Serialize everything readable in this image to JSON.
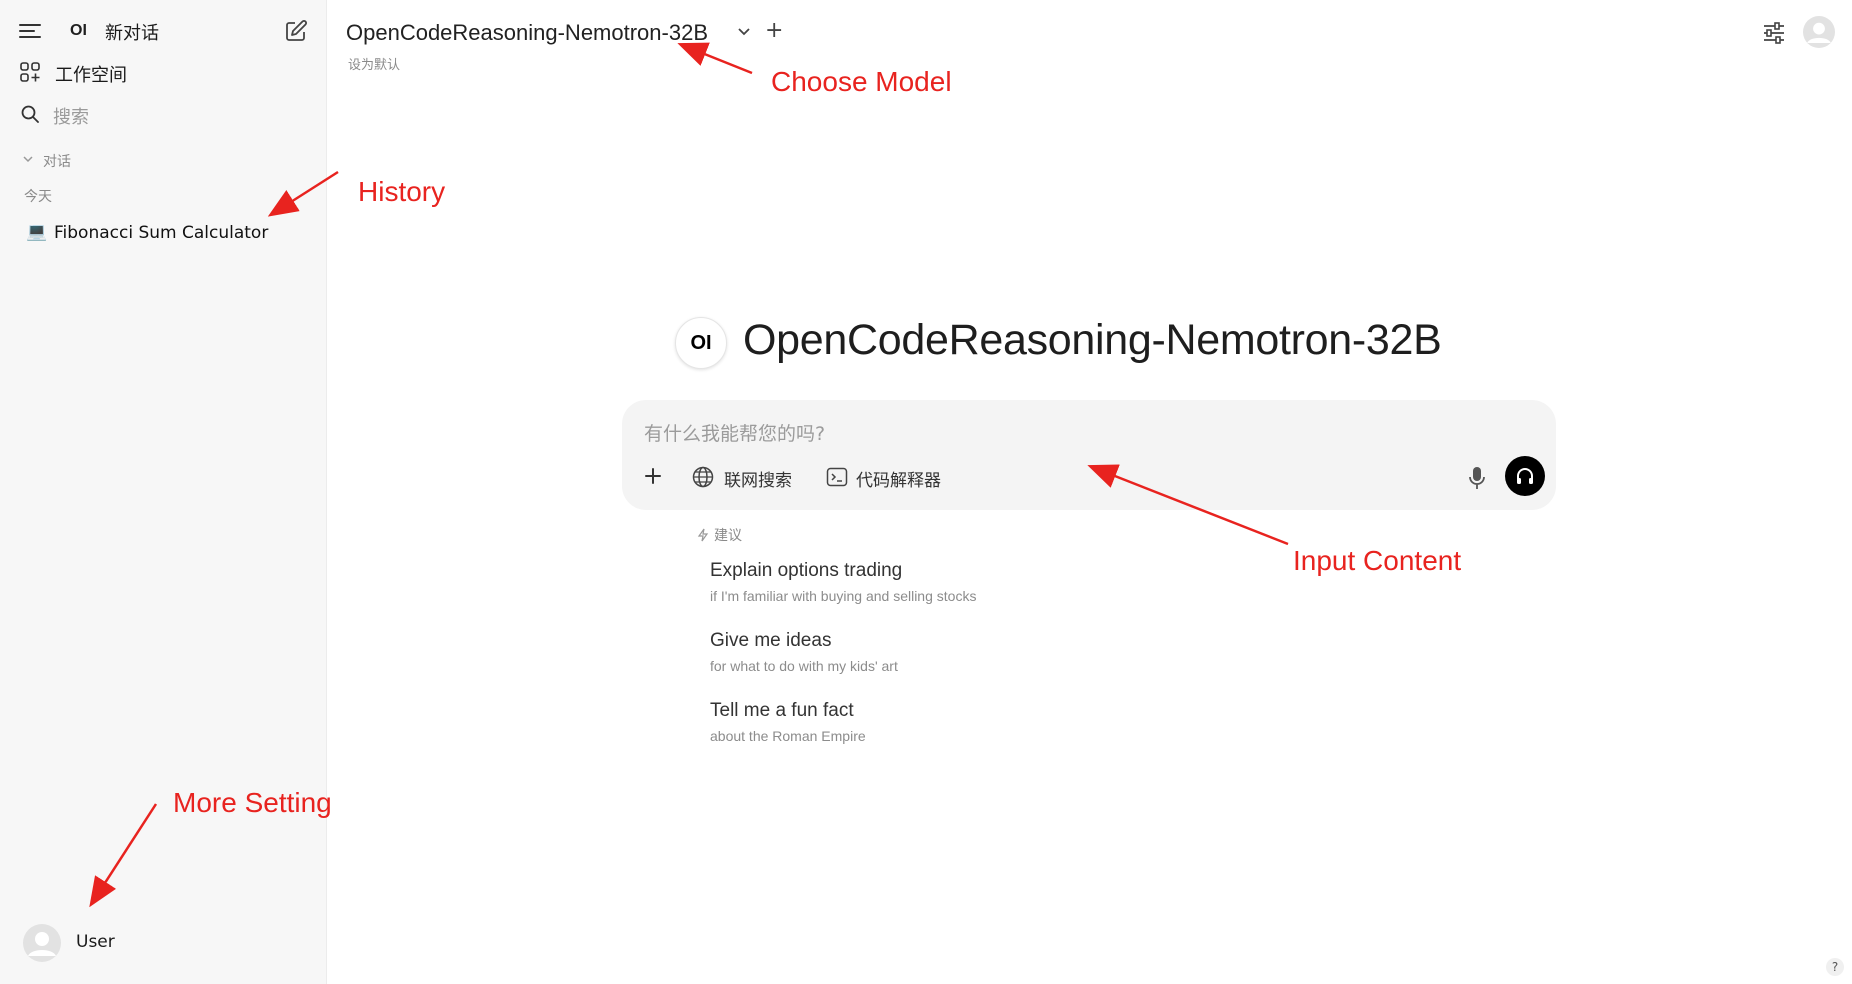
{
  "sidebar": {
    "logo_text": "OI",
    "new_chat_label": "新对话",
    "workspace_label": "工作空间",
    "search_placeholder": "搜索",
    "section_label": "对话",
    "group_today": "今天",
    "chats": [
      {
        "emoji": "💻",
        "title": "Fibonacci Sum Calculator"
      }
    ],
    "user_name": "User"
  },
  "header": {
    "model_name": "OpenCodeReasoning-Nemotron-32B",
    "set_default": "设为默认",
    "add_symbol": "+"
  },
  "main": {
    "logo_text": "OI",
    "title": "OpenCodeReasoning-Nemotron-32B",
    "input_placeholder": "有什么我能帮您的吗?",
    "tools": {
      "web_search": "联网搜索",
      "code_interpreter": "代码解释器"
    },
    "suggestions_label": "建议",
    "suggestions": [
      {
        "title": "Explain options trading",
        "subtitle": "if I'm familiar with buying and selling stocks"
      },
      {
        "title": "Give me ideas",
        "subtitle": "for what to do with my kids' art"
      },
      {
        "title": "Tell me a fun fact",
        "subtitle": "about the Roman Empire"
      }
    ]
  },
  "annotations": {
    "choose_model": "Choose Model",
    "history": "History",
    "input_content": "Input Content",
    "more_setting": "More Setting"
  },
  "help_label": "?",
  "colors": {
    "annotation": "#e8231f",
    "sidebar_bg": "#f7f7f7",
    "input_bg": "#f4f4f4"
  }
}
